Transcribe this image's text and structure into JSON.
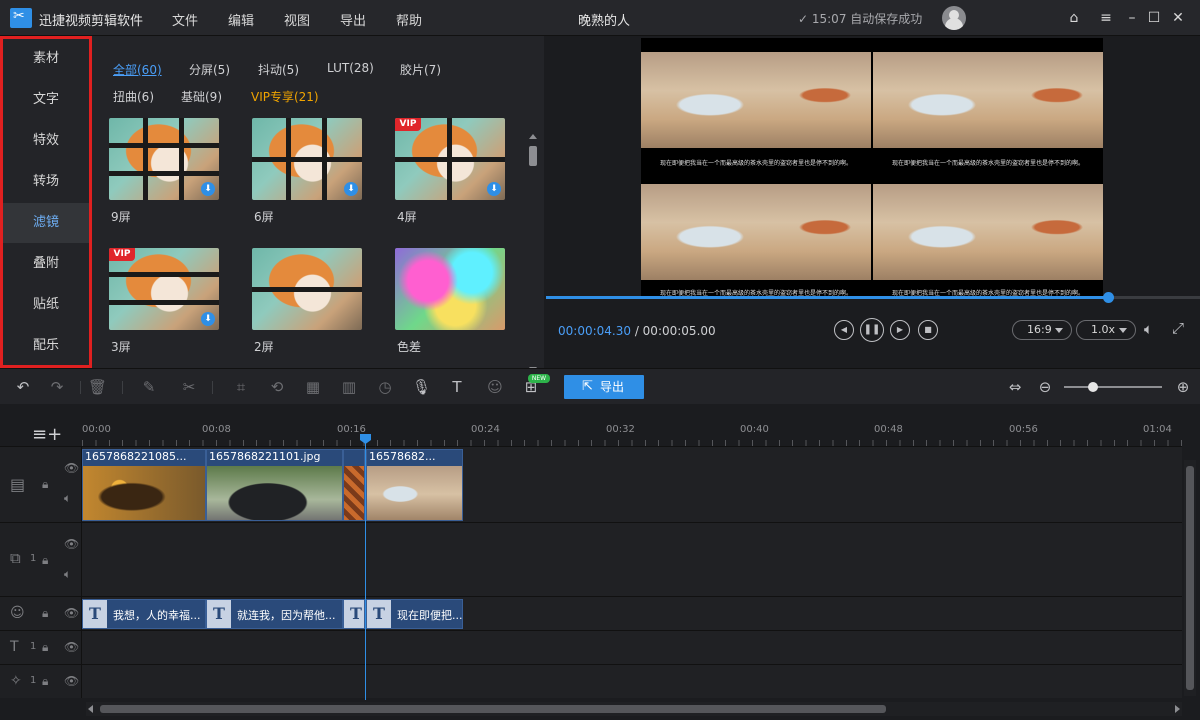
{
  "titlebar": {
    "app_name": "迅捷视频剪辑软件",
    "menu": [
      "文件",
      "编辑",
      "视图",
      "导出",
      "帮助"
    ],
    "doc_title": "晚熟的人",
    "save_status": "✓ 15:07 自动保存成功"
  },
  "categories": [
    "素材",
    "文字",
    "特效",
    "转场",
    "滤镜",
    "叠附",
    "贴纸",
    "配乐"
  ],
  "active_category": "滤镜",
  "filter_tabs": {
    "row1": [
      "全部(60)",
      "分屏(5)",
      "抖动(5)",
      "LUT(28)",
      "胶片(7)"
    ],
    "row2": [
      "扭曲(6)",
      "基础(9)",
      "VIP专享(21)"
    ]
  },
  "filters": [
    "9屏",
    "6屏",
    "4屏",
    "3屏",
    "2屏",
    "色差"
  ],
  "preview": {
    "subtitle": "现在即便把我当在一个而最高级的茶水壳里的盗窃者里也是停不到的啊。",
    "current_time": "00:00:04.30",
    "total_time": "/ 00:00:05.00",
    "progress": 0.86,
    "aspect": "16:9",
    "speed": "1.0x"
  },
  "toolbar": {
    "export_label": "导出",
    "new_badge": "NEW",
    "zoom_level": 0.3
  },
  "timeline": {
    "ruler": [
      "00:00",
      "00:08",
      "00:16",
      "00:24",
      "00:32",
      "00:40",
      "00:48",
      "00:56",
      "01:04"
    ],
    "video_clips": [
      "1657868221085...",
      "1657868221101.jpg",
      "",
      "16578682..."
    ],
    "text_clips": [
      "我想，人的幸福...",
      "就连我，因为帮他...",
      "",
      "现在即便把..."
    ],
    "track_index": "1"
  },
  "colors": {
    "accent": "#2f8fe6",
    "vip": "#f0a400",
    "highlight_border": "#e02020"
  }
}
